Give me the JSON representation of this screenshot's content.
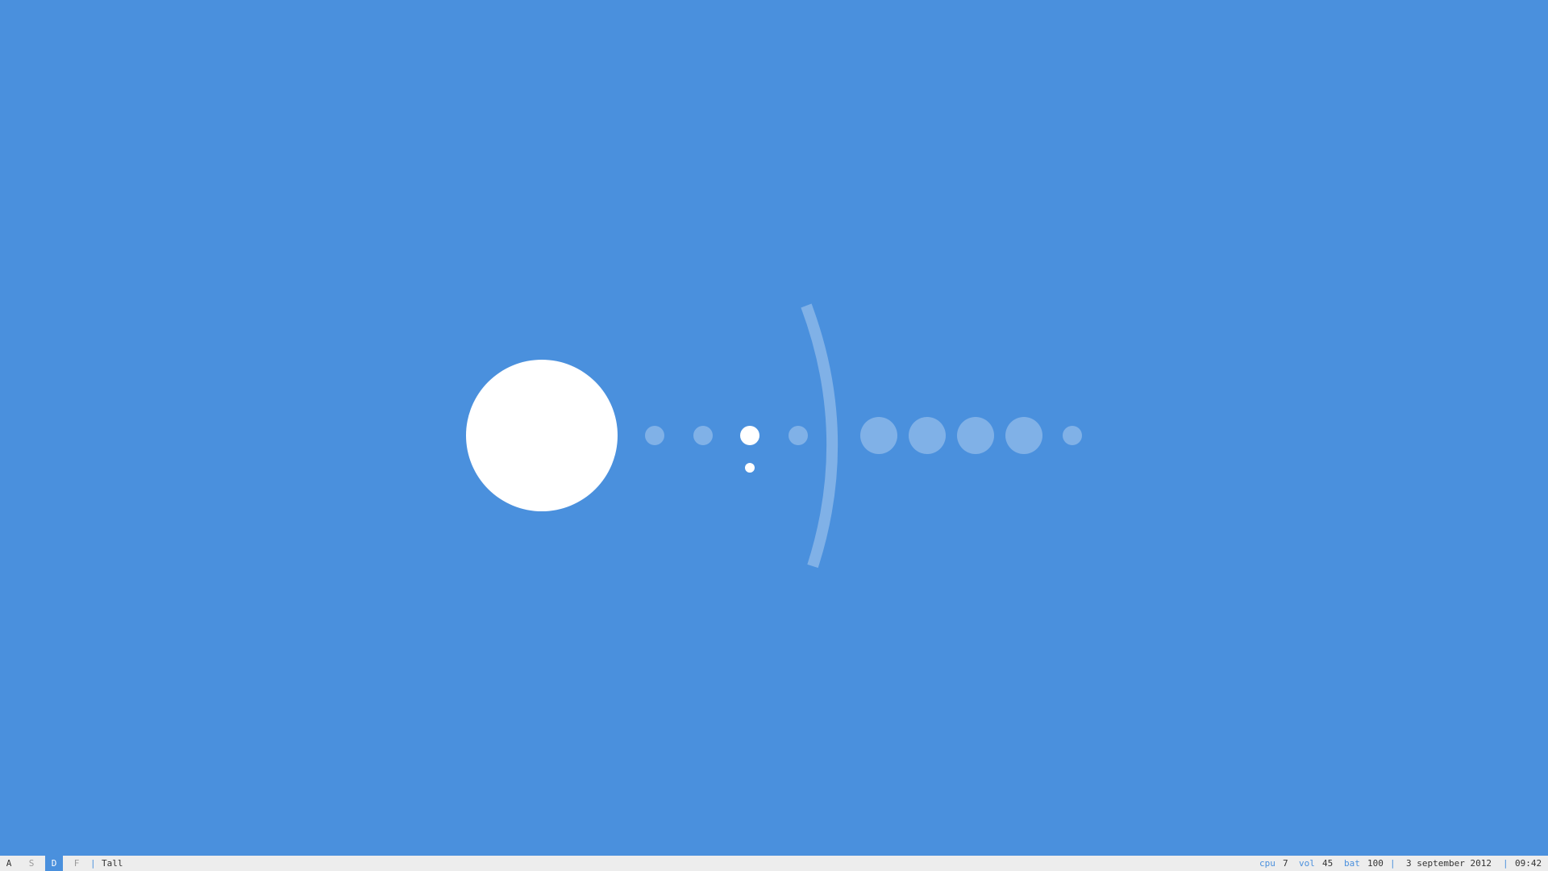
{
  "desktop": {
    "background_color": "#4a90dd"
  },
  "bar": {
    "workspaces": [
      {
        "label": "A",
        "state": "has-windows"
      },
      {
        "label": "S",
        "state": "empty"
      },
      {
        "label": "D",
        "state": "active"
      },
      {
        "label": "F",
        "state": "empty"
      }
    ],
    "separator": "|",
    "layout": "Tall",
    "status": {
      "cpu_label": "cpu",
      "cpu_value": "7",
      "vol_label": "vol",
      "vol_value": "45",
      "bat_label": "bat",
      "bat_value": "100",
      "date": "3 september 2012",
      "time": "09:42"
    },
    "colors": {
      "accent": "#4a90dd",
      "background": "#ededed",
      "text": "#333333",
      "inactive_text": "#9a9a9a"
    }
  }
}
